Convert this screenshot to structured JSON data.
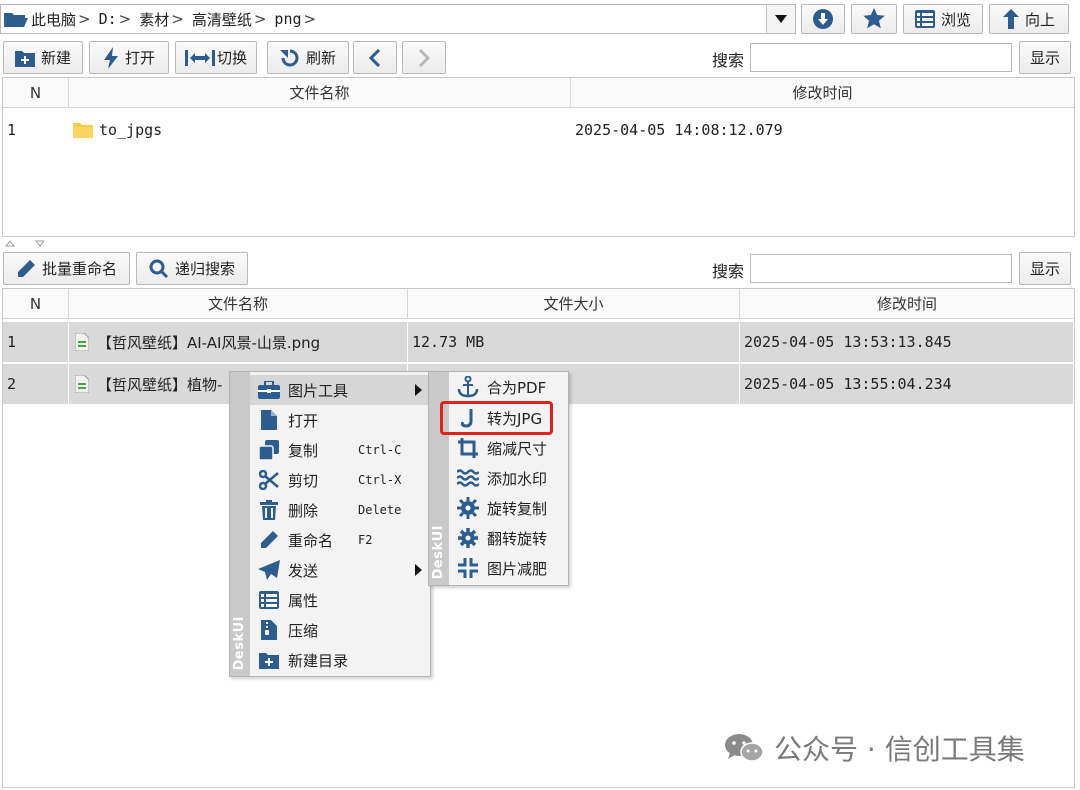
{
  "pathbar": {
    "crumbs": [
      "此电脑",
      "D:",
      "素材",
      "高清壁纸",
      "png"
    ],
    "separator": ">"
  },
  "top_buttons": {
    "browse_label": "浏览",
    "up_label": "向上"
  },
  "toolbar1": {
    "new_label": "新建",
    "open_label": "打开",
    "switch_label": "切换",
    "refresh_label": "刷新",
    "search_label": "搜索",
    "show_label": "显示",
    "search_value": ""
  },
  "table1": {
    "headers": [
      "N",
      "文件名称",
      "修改时间"
    ],
    "rows": [
      {
        "n": "1",
        "name": "to_jpgs",
        "modified": "2025-04-05 14:08:12.079"
      }
    ]
  },
  "toolbar2": {
    "batch_rename_label": "批量重命名",
    "recursive_search_label": "递归搜索",
    "search_label": "搜索",
    "show_label": "显示",
    "search_value": ""
  },
  "table2": {
    "headers": [
      "N",
      "文件名称",
      "文件大小",
      "修改时间"
    ],
    "rows": [
      {
        "n": "1",
        "name": "【哲风壁纸】AI-AI风景-山景.png",
        "size": "12.73 MB",
        "modified": "2025-04-05 13:53:13.845"
      },
      {
        "n": "2",
        "name": "【哲风壁纸】植物-",
        "size": "",
        "modified": "2025-04-05 13:55:04.234"
      }
    ]
  },
  "context_menu": {
    "brand": "DeskUI",
    "items": [
      {
        "label": "图片工具",
        "icon": "toolbox-icon",
        "shortcut": "",
        "submenu": true
      },
      {
        "label": "打开",
        "icon": "file-icon",
        "shortcut": "",
        "submenu": false
      },
      {
        "label": "复制",
        "icon": "copy-icon",
        "shortcut": "Ctrl-C",
        "submenu": false
      },
      {
        "label": "剪切",
        "icon": "scissors-icon",
        "shortcut": "Ctrl-X",
        "submenu": false
      },
      {
        "label": "删除",
        "icon": "trash-icon",
        "shortcut": "Delete",
        "submenu": false
      },
      {
        "label": "重命名",
        "icon": "pencil-icon",
        "shortcut": "F2",
        "submenu": false
      },
      {
        "label": "发送",
        "icon": "send-icon",
        "shortcut": "",
        "submenu": true
      },
      {
        "label": "属性",
        "icon": "list-icon",
        "shortcut": "",
        "submenu": false
      },
      {
        "label": "压缩",
        "icon": "zip-icon",
        "shortcut": "",
        "submenu": false
      },
      {
        "label": "新建目录",
        "icon": "new-folder-icon",
        "shortcut": "",
        "submenu": false
      }
    ]
  },
  "submenu": {
    "brand": "DeskUI",
    "items": [
      {
        "label": "合为PDF",
        "icon": "anchor-icon"
      },
      {
        "label": "转为JPG",
        "icon": "j-icon"
      },
      {
        "label": "缩减尺寸",
        "icon": "crop-icon"
      },
      {
        "label": "添加水印",
        "icon": "water-icon"
      },
      {
        "label": "旋转复制",
        "icon": "gear-icon"
      },
      {
        "label": "翻转旋转",
        "icon": "cog-icon"
      },
      {
        "label": "图片减肥",
        "icon": "compress-icon"
      }
    ]
  },
  "watermark": {
    "text": "公众号 · 信创工具集"
  },
  "colors": {
    "icon_blue": "#2d5d8e",
    "selection_gray": "#d9d9d9",
    "highlight_red": "#e0231b",
    "folder_yellow": "#f7c948"
  }
}
